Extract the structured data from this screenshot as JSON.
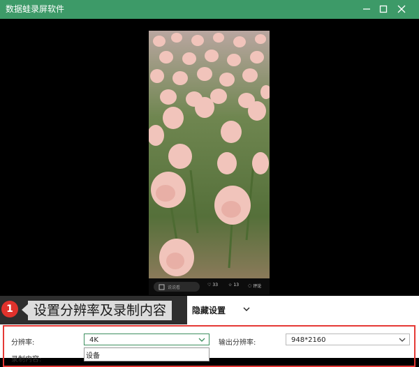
{
  "window": {
    "title": "数据蛙录屏软件"
  },
  "preview": {
    "comment_placeholder": "说说看",
    "likes": "33",
    "favorites": "13",
    "comments": "评论"
  },
  "callout": {
    "number": "1",
    "text": "设置分辨率及录制内容"
  },
  "settings": {
    "hide_label": "隐藏设置",
    "resolution_label": "分辨率:",
    "resolution_value": "4K",
    "output_resolution_label": "输出分辨率:",
    "output_resolution_value": "948*2160",
    "record_content_label": "录制内容:",
    "dropdown_option": "设备"
  },
  "colors": {
    "title_bar": "#3d9a68",
    "highlight_box": "#e53935",
    "badge": "#e0322c"
  }
}
